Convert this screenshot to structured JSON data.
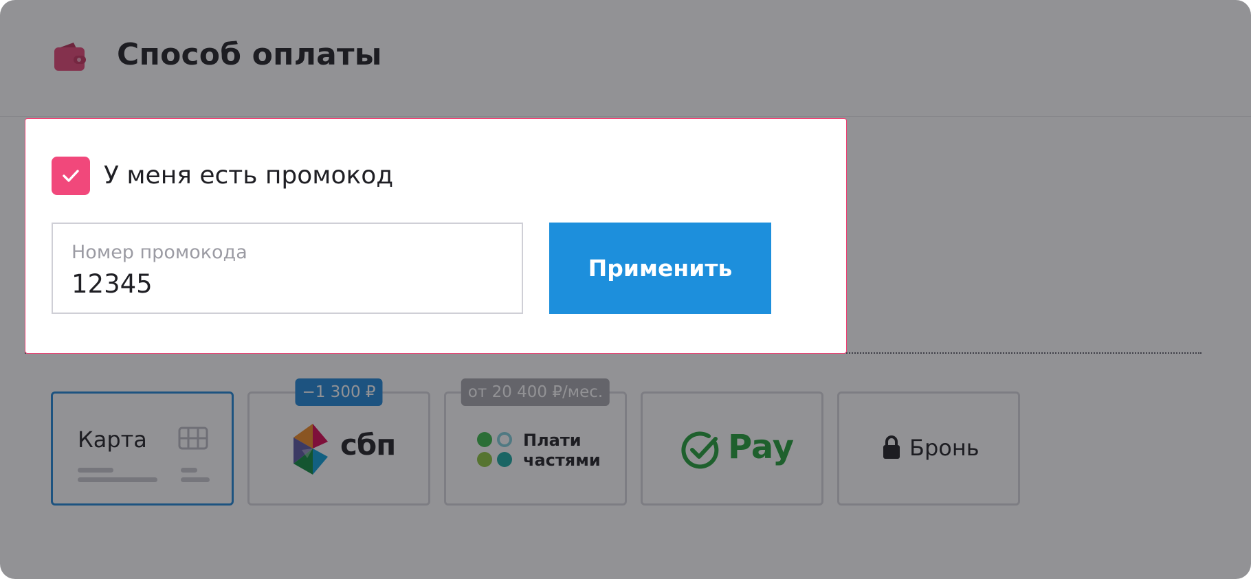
{
  "header": {
    "title": "Способ оплаты",
    "icon": "wallet-icon",
    "icon_color": "#d33a66"
  },
  "promo": {
    "checkbox_label": "У меня есть промокод",
    "checkbox_checked": true,
    "field_label": "Номер промокода",
    "field_value": "12345",
    "apply_label": "Применить",
    "accent_color": "#f1487b",
    "button_color": "#1d8fdc"
  },
  "payment_methods": [
    {
      "id": "card",
      "label": "Карта",
      "icon": "card-chip-icon",
      "selected": true
    },
    {
      "id": "sbp",
      "label": "сбп",
      "icon": "sbp-logo-icon",
      "badge": "−1 300 ₽"
    },
    {
      "id": "installments",
      "label_line1": "Плати",
      "label_line2": "частями",
      "icon": "installments-dots-icon",
      "badge": "от 20 400 ₽/мес."
    },
    {
      "id": "sberpay",
      "label": "Pay",
      "icon": "sber-check-icon",
      "color": "#21a038"
    },
    {
      "id": "booking",
      "label": "Бронь",
      "icon": "lock-icon"
    }
  ]
}
